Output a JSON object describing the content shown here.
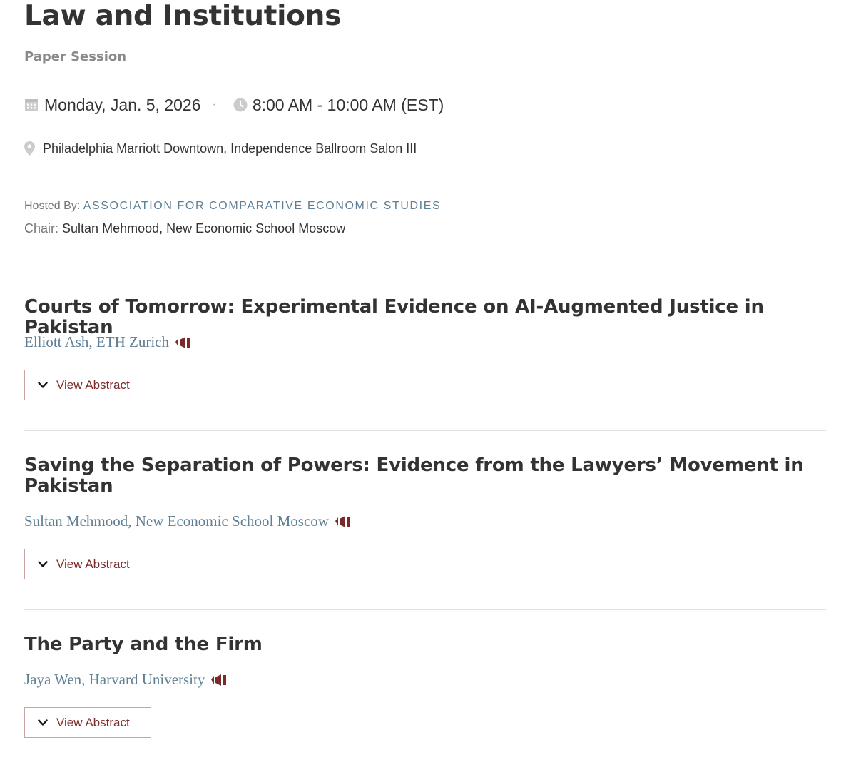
{
  "session": {
    "title": "Law and Institutions",
    "type": "Paper Session",
    "date": "Monday, Jan. 5, 2026",
    "time": "8:00 AM - 10:00 AM (EST)",
    "location": "Philadelphia Marriott Downtown, Independence Ballroom Salon III",
    "hosted_label": "Hosted By:",
    "host": "ASSOCIATION FOR COMPARATIVE ECONOMIC STUDIES",
    "chair_label": "Chair:",
    "chair": "Sultan Mehmood, New Economic School Moscow"
  },
  "separator": "·",
  "icons": {
    "date": "calendar-icon",
    "time": "clock-icon",
    "location": "map-pin-icon",
    "presenter": "megaphone-icon",
    "expand": "chevron-down-icon"
  },
  "colors": {
    "text": "#333333",
    "muted": "#8a8a8a",
    "link": "#5f7f94",
    "accent": "#7a2a2a",
    "button_border": "#c9a4a4"
  },
  "papers": [
    {
      "title": "Courts of Tomorrow: Experimental Evidence on AI-Augmented Justice in Pakistan",
      "author": "Elliott Ash, ETH Zurich",
      "button_label": "View Abstract"
    },
    {
      "title": "Saving the Separation of Powers: Evidence from the Lawyers’ Movement in Pakistan",
      "author": "Sultan Mehmood, New Economic School Moscow",
      "button_label": "View Abstract"
    },
    {
      "title": "The Party and the Firm",
      "author": "Jaya Wen, Harvard University",
      "button_label": "View Abstract"
    }
  ]
}
